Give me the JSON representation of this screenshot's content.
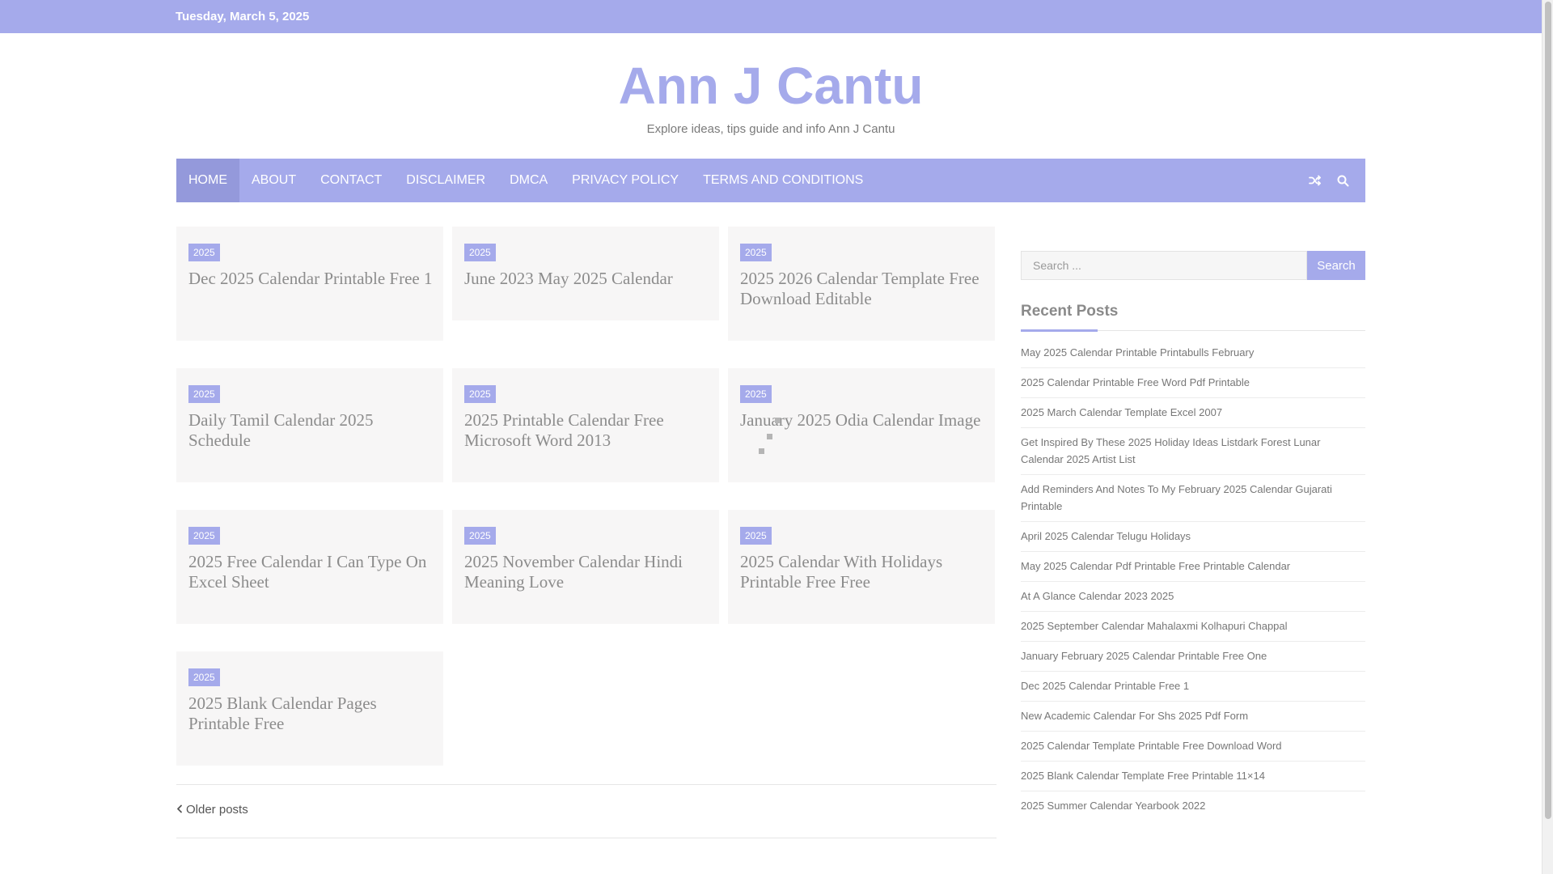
{
  "topbar": {
    "date": "Tuesday, March 5, 2025"
  },
  "site": {
    "title": "Ann J Cantu",
    "description": "Explore ideas, tips guide and info Ann J Cantu"
  },
  "nav": {
    "items": [
      {
        "label": "HOME",
        "active": true
      },
      {
        "label": "ABOUT"
      },
      {
        "label": "CONTACT"
      },
      {
        "label": "DISCLAIMER"
      },
      {
        "label": "DMCA"
      },
      {
        "label": "PRIVACY POLICY"
      },
      {
        "label": "TERMS AND CONDITIONS"
      }
    ],
    "icons": [
      "shuffle-icon",
      "search-icon"
    ]
  },
  "posts": [
    {
      "category": "2025",
      "title": "Dec 2025 Calendar Printable Free 1"
    },
    {
      "category": "2025",
      "title": "June 2023 May 2025 Calendar"
    },
    {
      "category": "2025",
      "title": "2025 2026 Calendar Template Free Download Editable"
    },
    {
      "category": "2025",
      "title": "Daily Tamil Calendar 2025 Schedule"
    },
    {
      "category": "2025",
      "title": "2025 Printable Calendar Free Microsoft Word 2013"
    },
    {
      "category": "2025",
      "title": "January 2025 Odia Calendar Image"
    },
    {
      "category": "2025",
      "title": "2025 Free Calendar I Can Type On Excel Sheet"
    },
    {
      "category": "2025",
      "title": "2025 November Calendar Hindi Meaning Love"
    },
    {
      "category": "2025",
      "title": "2025 Calendar With Holidays Printable Free Free"
    },
    {
      "category": "2025",
      "title": "2025 Blank Calendar Pages Printable Free"
    }
  ],
  "pagination": {
    "older_label": "Older posts"
  },
  "sidebar": {
    "search": {
      "placeholder": "Search ...",
      "button_label": "Search"
    },
    "recent_title": "Recent Posts",
    "recent_posts": [
      "May 2025 Calendar Printable Printabulls February",
      "2025 Calendar Printable Free Word Pdf Printable",
      "2025 March Calendar Template Excel 2007",
      "Get Inspired By These 2025 Holiday Ideas Listdark Forest Lunar Calendar 2025 Artist List",
      "Add Reminders And Notes To My February 2025 Calendar Gujarati Printable",
      "April 2025 Calendar Telugu Holidays",
      "May 2025 Calendar Pdf Printable Free Printable Calendar",
      "At A Glance Calendar 2023 2025",
      "2025 September Calendar Mahalaxmi Kolhapuri Chappal",
      "January February 2025 Calendar Printable Free One",
      "Dec 2025 Calendar Printable Free 1",
      "New Academic Calendar For Shs 2025 Pdf Form",
      "2025 Calendar Template Printable Free Download Word",
      "2025 Blank Calendar Template Free Printable 11×14",
      "2025 Summer Calendar Yearbook 2022"
    ]
  },
  "colors": {
    "accent": "#a5aaeb",
    "card_bg": "#f7f6f6"
  }
}
